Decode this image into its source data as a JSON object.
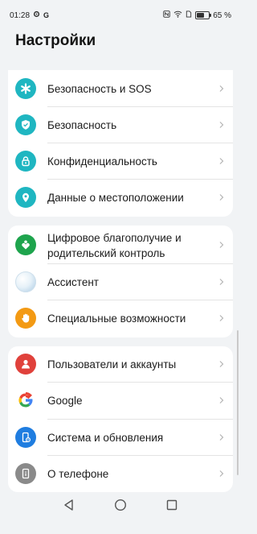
{
  "status_bar": {
    "time": "01:28",
    "left_icons": [
      "gear-icon",
      "google-g-icon"
    ],
    "right_icons": [
      "nfc-icon",
      "wifi-icon",
      "sim-icon",
      "battery-icon"
    ],
    "battery_percent": "65 %"
  },
  "page": {
    "title": "Настройки"
  },
  "groups": [
    {
      "items": [
        {
          "label": "Безопасность и SOS",
          "icon": "asterisk-icon",
          "color": "#1fb6c1"
        },
        {
          "label": "Безопасность",
          "icon": "shield-check-icon",
          "color": "#1fb6c1"
        },
        {
          "label": "Конфиденциальность",
          "icon": "lock-icon",
          "color": "#1fb6c1"
        },
        {
          "label": "Данные о местоположении",
          "icon": "location-pin-icon",
          "color": "#1fb6c1"
        }
      ]
    },
    {
      "items": [
        {
          "label": "Цифровое благополучие и родительский контроль",
          "icon": "digital-wellbeing-icon",
          "color": "#1ea44d"
        },
        {
          "label": "Ассистент",
          "icon": "assistant-orb-icon",
          "color": "#cfe4f3"
        },
        {
          "label": "Специальные возможности",
          "icon": "hand-icon",
          "color": "#f39a14"
        }
      ]
    },
    {
      "items": [
        {
          "label": "Пользователи и аккаунты",
          "icon": "user-icon",
          "color": "#e0413b"
        },
        {
          "label": "Google",
          "icon": "google-icon",
          "color": "#ffffff"
        },
        {
          "label": "Система и обновления",
          "icon": "phone-settings-icon",
          "color": "#1f7de0"
        },
        {
          "label": "О телефоне",
          "icon": "phone-info-icon",
          "color": "#8a8a8a"
        }
      ]
    }
  ],
  "nav_bar": {
    "buttons": [
      "back-triangle-icon",
      "home-circle-icon",
      "recents-square-icon"
    ]
  }
}
